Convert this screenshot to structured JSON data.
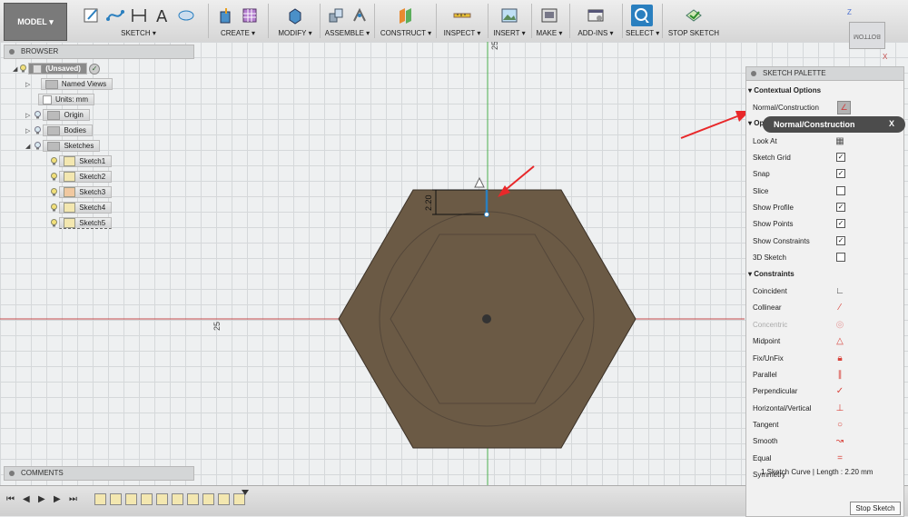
{
  "toolbar": {
    "workspace": "MODEL",
    "groups": [
      "SKETCH",
      "CREATE",
      "MODIFY",
      "ASSEMBLE",
      "CONSTRUCT",
      "INSPECT",
      "INSERT",
      "MAKE",
      "ADD-INS",
      "SELECT",
      "STOP SKETCH"
    ]
  },
  "browser": {
    "title": "BROWSER",
    "root": "(Unsaved)",
    "items": [
      "Named Views",
      "Units: mm",
      "Origin",
      "Bodies",
      "Sketches"
    ],
    "sketches": [
      "Sketch1",
      "Sketch2",
      "Sketch3",
      "Sketch4",
      "Sketch5"
    ]
  },
  "comments": {
    "title": "COMMENTS"
  },
  "canvas": {
    "axis_label_top": "25",
    "axis_label_left": "25",
    "dimension": "2.20",
    "viewcube_label": "BOTTOM",
    "axis_z": "Z",
    "axis_x": "X"
  },
  "palette": {
    "title": "SKETCH PALETTE",
    "contextual_heading": "Contextual Options",
    "normal_construction": "Normal/Construction",
    "options_heading": "Options",
    "options": [
      {
        "label": "Look At",
        "checked": null
      },
      {
        "label": "Sketch Grid",
        "checked": true
      },
      {
        "label": "Snap",
        "checked": true
      },
      {
        "label": "Slice",
        "checked": false
      },
      {
        "label": "Show Profile",
        "checked": true
      },
      {
        "label": "Show Points",
        "checked": true
      },
      {
        "label": "Show Constraints",
        "checked": true
      },
      {
        "label": "3D Sketch",
        "checked": false
      }
    ],
    "constraints_heading": "Constraints",
    "constraints": [
      "Coincident",
      "Collinear",
      "Concentric",
      "Midpoint",
      "Fix/UnFix",
      "Parallel",
      "Perpendicular",
      "Horizontal/Vertical",
      "Tangent",
      "Smooth",
      "Equal",
      "Symmetry"
    ],
    "stop_sketch": "Stop Sketch"
  },
  "tooltip": {
    "label": "Normal/Construction",
    "close": "X"
  },
  "status": "1 Sketch Curve | Length : 2.20 mm",
  "colors": {
    "accent": "#2a7fbf",
    "annotation": "#e8282a",
    "hexagon": "#6b5a45",
    "x_axis": "#c44a4a",
    "y_axis": "#4caf50"
  }
}
